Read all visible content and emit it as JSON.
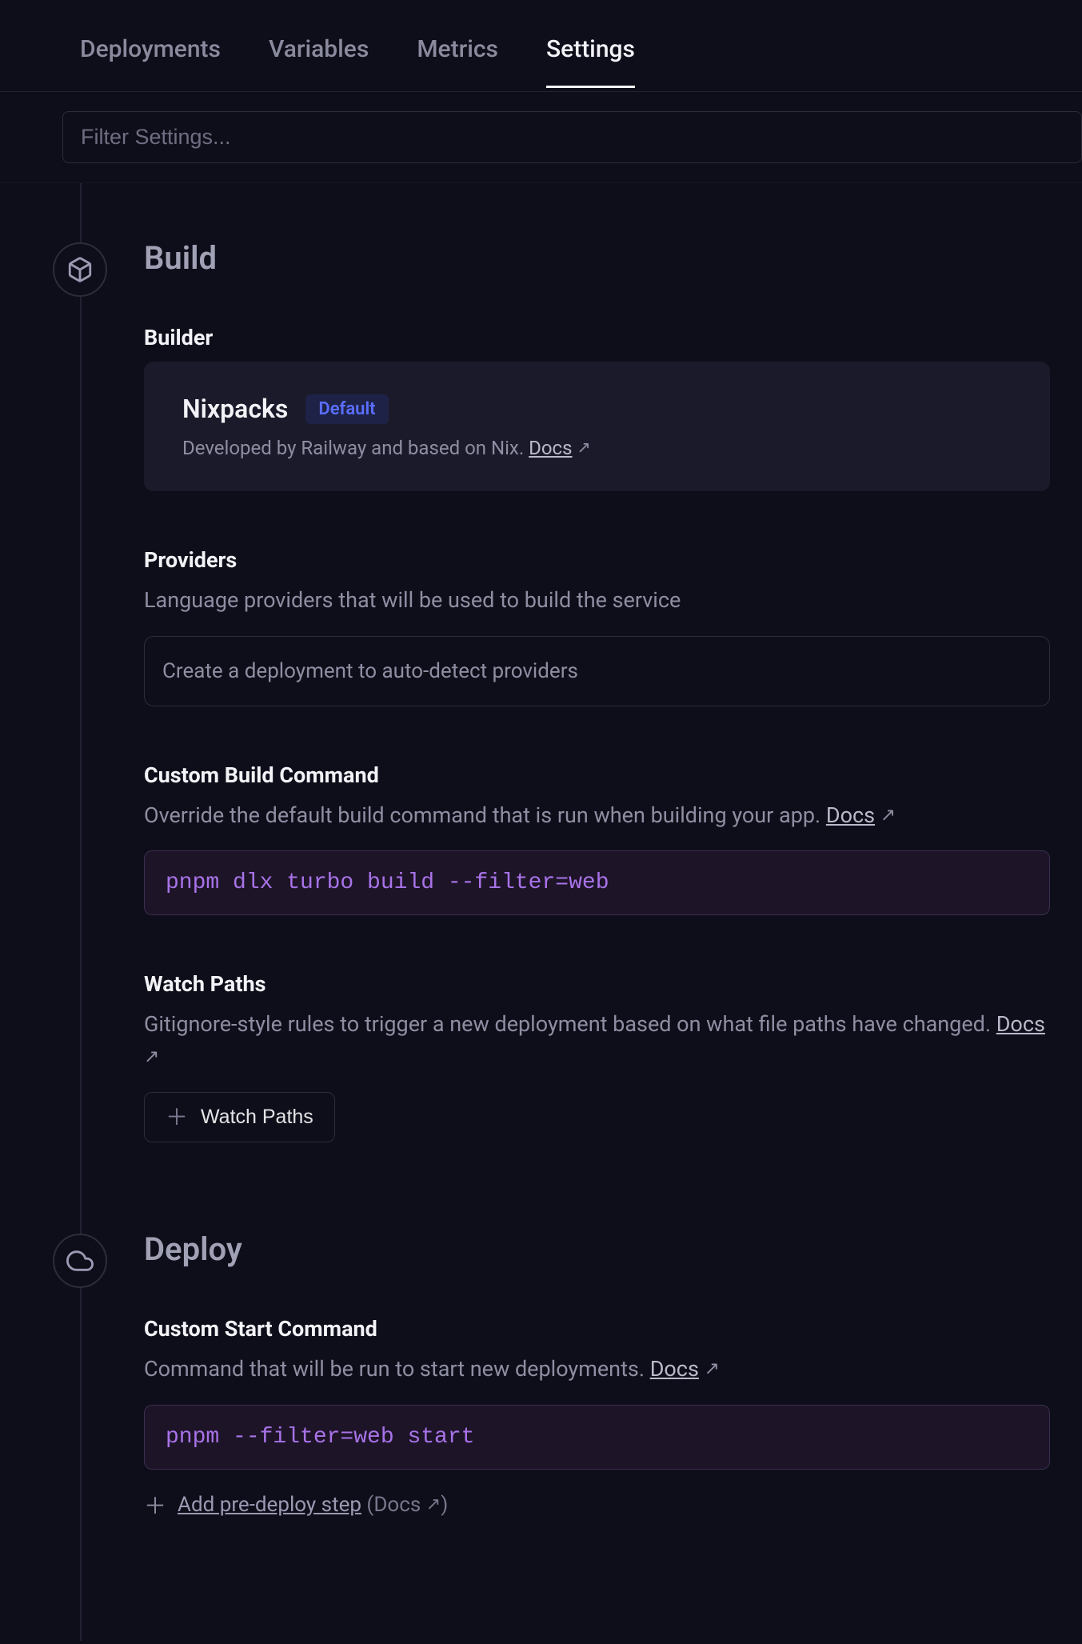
{
  "tabs": {
    "deployments": "Deployments",
    "variables": "Variables",
    "metrics": "Metrics",
    "settings": "Settings"
  },
  "filter": {
    "placeholder": "Filter Settings..."
  },
  "build": {
    "title": "Build",
    "builder": {
      "heading": "Builder",
      "name": "Nixpacks",
      "default_badge": "Default",
      "desc_prefix": "Developed by Railway and based on Nix. ",
      "docs_label": "Docs"
    },
    "providers": {
      "heading": "Providers",
      "desc": "Language providers that will be used to build the service",
      "empty": "Create a deployment to auto-detect providers"
    },
    "custom_build": {
      "heading": "Custom Build Command",
      "desc_prefix": "Override the default build command that is run when building your app. ",
      "docs_label": "Docs",
      "value": "pnpm dlx turbo build --filter=web"
    },
    "watch_paths": {
      "heading": "Watch Paths",
      "desc_prefix": "Gitignore-style rules to trigger a new deployment based on what file paths have changed. ",
      "docs_label": "Docs",
      "button": "Watch Paths"
    }
  },
  "deploy": {
    "title": "Deploy",
    "custom_start": {
      "heading": "Custom Start Command",
      "desc_prefix": "Command that will be run to start new deployments. ",
      "docs_label": "Docs",
      "value": "pnpm --filter=web start"
    },
    "pre_deploy": {
      "label": "Add pre-deploy step",
      "paren_prefix": " (",
      "docs_label": "Docs",
      "paren_suffix": ")"
    }
  }
}
